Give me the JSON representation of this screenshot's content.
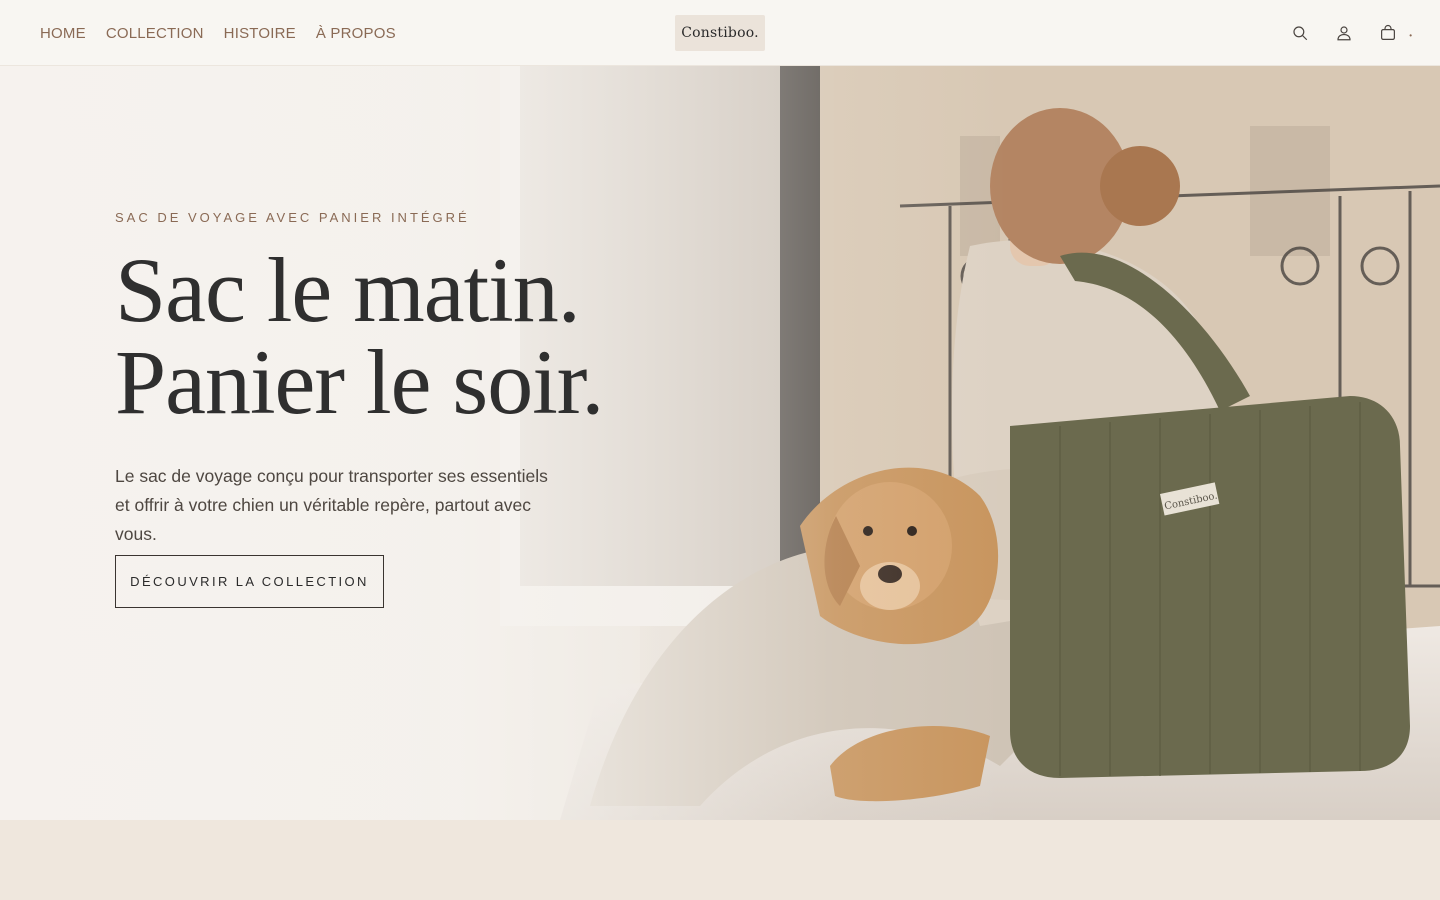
{
  "header": {
    "nav": [
      {
        "label": "HOME"
      },
      {
        "label": "COLLECTION"
      },
      {
        "label": "HISTOIRE"
      },
      {
        "label": "À PROPOS"
      }
    ],
    "logo_text": "Constiboo.",
    "cart_count": "•"
  },
  "hero": {
    "eyebrow": "SAC DE VOYAGE AVEC PANIER INTÉGRÉ",
    "headline_line1": "Sac le matin.",
    "headline_line2": "Panier le soir.",
    "subtitle": "Le sac de voyage conçu pour transporter ses essentiels et offrir à votre chien un véritable repère, partout avec vous.",
    "cta_label": "DÉCOUVRIR LA COLLECTION",
    "bag_label": "Constiboo."
  },
  "colors": {
    "accent_brown": "#8a6a55",
    "text_dark": "#2f2f2f",
    "bag_olive": "#6b6a4e",
    "beige_bg": "#efe7dd"
  },
  "icons": [
    "search-icon",
    "account-icon",
    "cart-icon"
  ]
}
